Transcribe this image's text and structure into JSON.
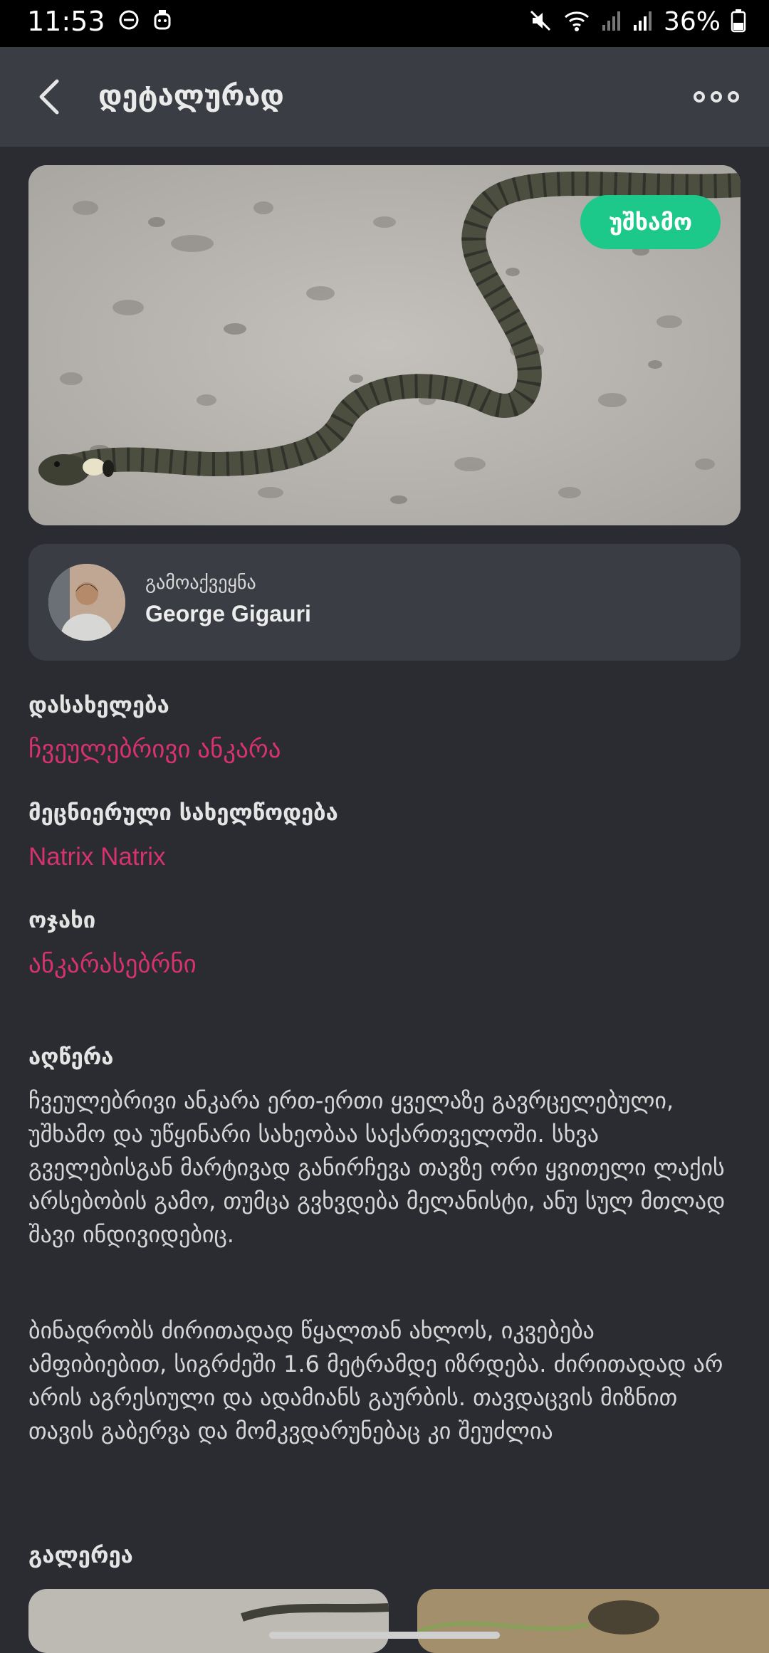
{
  "status_bar": {
    "time": "11:53",
    "battery": "36%"
  },
  "header": {
    "title": "დეტალურად"
  },
  "hero": {
    "badge": "უშხამო",
    "badge_color": "#1cc88a"
  },
  "author": {
    "label": "გამოაქვეყნა",
    "name": "George Gigauri"
  },
  "fields": {
    "name_label": "დასახელება",
    "name_value": "ჩვეულებრივი ანკარა",
    "scientific_label": "მეცნიერული სახელწოდება",
    "scientific_value": "Natrix Natrix",
    "family_label": "ოჯახი",
    "family_value": "ანკარასებრნი",
    "value_color": "#d6336c"
  },
  "description": {
    "label": "აღწერა",
    "p1": "ჩვეულებრივი ანკარა ერთ-ერთი ყველაზე გავრცელებული, უშხამო და უწყინარი სახეობაა საქართველოში. სხვა გველებისგან მარტივად განირჩევა თავზე ორი ყვითელი ლაქის არსებობის გამო, თუმცა გვხვდება მელანისტი, ანუ სულ მთლად შავი ინდივიდებიც.",
    "p2": "ბინადრობს ძირითადად წყალთან ახლოს, იკვებება ამფიბიებით, სიგრძეში 1.6 მეტრამდე იზრდება. ძირითადად არ არის აგრესიული და ადამიანს გაურბის. თავდაცვის მიზნით თავის გაბერვა და მომკვდარუნებაც კი შეუძლია"
  },
  "gallery": {
    "label": "გალერეა"
  }
}
